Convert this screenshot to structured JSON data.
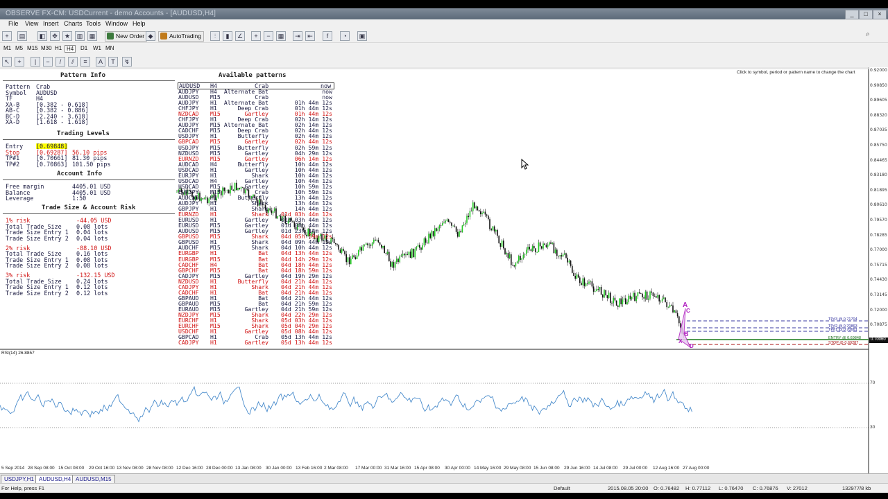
{
  "window": {
    "title": "OBSERVE FX-CM: USDCurrent - demo Accounts - [AUDUSD,H4]"
  },
  "menu": [
    "File",
    "View",
    "Insert",
    "Charts",
    "Tools",
    "Window",
    "Help"
  ],
  "toolbar": {
    "new_order": "New Order",
    "autotrading": "AutoTrading"
  },
  "timeframes": [
    "M1",
    "M5",
    "M15",
    "M30",
    "H1",
    "H4",
    "D1",
    "W1",
    "MN"
  ],
  "active_timeframe": "H4",
  "hint_text": "Click to symbol, period or pattern name to change the chart",
  "pattern_info": {
    "header": "Pattern Info",
    "rows": [
      {
        "k": "Pattern",
        "v": "Crab"
      },
      {
        "k": "Symbol",
        "v": "AUDUSD"
      },
      {
        "k": "TF",
        "v": "H4"
      },
      {
        "k": "XA-B",
        "v": "[0.382 - 0.618]"
      },
      {
        "k": "AB-C",
        "v": "[0.382 - 0.886]"
      },
      {
        "k": "BC-D",
        "v": "[2.240 - 3.618]"
      },
      {
        "k": "XA-D",
        "v": "[1.618 - 1.618]"
      }
    ]
  },
  "trading_levels": {
    "header": "Trading Levels",
    "rows": [
      {
        "k": "Entry",
        "v": "[0.69848]",
        "pips": "",
        "color": "dark"
      },
      {
        "k": "Stop",
        "v": "[0.69287]",
        "pips": "56.10 pips",
        "color": "red"
      },
      {
        "k": "TP#1",
        "v": "[0.70661]",
        "pips": "81.30 pips",
        "color": "dark"
      },
      {
        "k": "TP#2",
        "v": "[0.70863]",
        "pips": "101.50 pips",
        "color": "dark"
      }
    ]
  },
  "account_info": {
    "header": "Account Info",
    "rows": [
      {
        "k": "Free margin",
        "v": "4405.01 USD"
      },
      {
        "k": "Balance",
        "v": "4405.01 USD"
      },
      {
        "k": "Leverage",
        "v": "1:50"
      }
    ]
  },
  "trade_size": {
    "header": "Trade Size & Account Risk",
    "groups": [
      {
        "risk": "1% risk",
        "amount": "-44.05 USD",
        "total": "0.08 lots",
        "e1": "0.04 lots",
        "e2": "0.04 lots"
      },
      {
        "risk": "2% risk",
        "amount": "-88.10 USD",
        "total": "0.16 lots",
        "e1": "0.08 lots",
        "e2": "0.08 lots"
      },
      {
        "risk": "3% risk",
        "amount": "-132.15 USD",
        "total": "0.24 lots",
        "e1": "0.12 lots",
        "e2": "0.12 lots"
      }
    ],
    "labels": {
      "total": "Total Trade Size",
      "e1": "Trade Size Entry 1",
      "e2": "Trade Size Entry 2"
    }
  },
  "available_patterns": {
    "header": "Available patterns",
    "columns": [
      "AUDUSD",
      "H4",
      "Crab",
      "now"
    ],
    "rows": [
      [
        "AUDJPY",
        "H4",
        "Alternate Bat",
        "now",
        "d"
      ],
      [
        "AUDUSD",
        "M15",
        "Crab",
        "now",
        "d"
      ],
      [
        "AUDJPY",
        "H1",
        "Alternate Bat",
        "01h 44m 12s",
        "d"
      ],
      [
        "CHFJPY",
        "H1",
        "Deep Crab",
        "01h 44m 12s",
        "d"
      ],
      [
        "NZDCAD",
        "M15",
        "Gartley",
        "01h 44m 12s",
        "r"
      ],
      [
        "CHFJPY",
        "H1",
        "Deep Crab",
        "02h 14m 12s",
        "d"
      ],
      [
        "AUDJPY",
        "M15",
        "Alternate Bat",
        "02h 14m 12s",
        "d"
      ],
      [
        "CADCHF",
        "M15",
        "Deep Crab",
        "02h 44m 12s",
        "d"
      ],
      [
        "USDJPY",
        "H1",
        "Butterfly",
        "02h 44m 12s",
        "d"
      ],
      [
        "GBPCAD",
        "M15",
        "Gartley",
        "02h 44m 12s",
        "r"
      ],
      [
        "USDJPY",
        "M15",
        "Butterfly",
        "02h 59m 12s",
        "d"
      ],
      [
        "NZDUSD",
        "M15",
        "Gartley",
        "04h 29m 12s",
        "d"
      ],
      [
        "EURNZD",
        "M15",
        "Gartley",
        "06h 14m 12s",
        "r"
      ],
      [
        "AUDCAD",
        "H4",
        "Butterfly",
        "10h 44m 12s",
        "d"
      ],
      [
        "USDCAD",
        "H1",
        "Gartley",
        "10h 44m 12s",
        "d"
      ],
      [
        "EURJPY",
        "H1",
        "Shark",
        "10h 44m 12s",
        "d"
      ],
      [
        "USDCAD",
        "H4",
        "Gartley",
        "10h 44m 12s",
        "d"
      ],
      [
        "USDCAD",
        "M15",
        "Gartley",
        "10h 59m 12s",
        "d"
      ],
      [
        "EURJPY",
        "M15",
        "Crab",
        "10h 59m 12s",
        "d"
      ],
      [
        "AUDCAD",
        "H1",
        "Butterfly",
        "13h 44m 12s",
        "d"
      ],
      [
        "AUDJPY",
        "H1",
        "Shark",
        "13h 44m 12s",
        "d"
      ],
      [
        "GBPJPY",
        "H1",
        "Shark",
        "14h 44m 12s",
        "d"
      ],
      [
        "EURNZD",
        "H1",
        "Shark",
        "01d 03h 44m 12s",
        "r"
      ],
      [
        "EURUSD",
        "H1",
        "Gartley",
        "01d 03h 44m 12s",
        "d"
      ],
      [
        "EURUSD",
        "M15",
        "Gartley",
        "01d 08h 44m 12s",
        "d"
      ],
      [
        "AUDUSD",
        "M15",
        "Gartley",
        "01d 23h 14m 12s",
        "d"
      ],
      [
        "GBPUSD",
        "M15",
        "Shark",
        "04d 05h 59m 12s",
        "r"
      ],
      [
        "GBPUSD",
        "H1",
        "Shark",
        "04d 09h 44m 12s",
        "d"
      ],
      [
        "AUDCHF",
        "M15",
        "Shark",
        "04d 10h 44m 12s",
        "d"
      ],
      [
        "EURGBP",
        "H1",
        "Bat",
        "04d 13h 44m 12s",
        "r"
      ],
      [
        "EURGBP",
        "M15",
        "Bat",
        "04d 14h 29m 12s",
        "r"
      ],
      [
        "CADCHF",
        "H4",
        "Bat",
        "04d 18h 44m 12s",
        "r"
      ],
      [
        "GBPCHF",
        "M15",
        "Bat",
        "04d 18h 59m 12s",
        "r"
      ],
      [
        "CADJPY",
        "M15",
        "Gartley",
        "04d 19h 29m 12s",
        "d"
      ],
      [
        "NZDUSD",
        "H1",
        "Butterfly",
        "04d 21h 44m 12s",
        "r"
      ],
      [
        "CADJPY",
        "H1",
        "Shark",
        "04d 21h 44m 12s",
        "r"
      ],
      [
        "CADCHF",
        "H1",
        "Bat",
        "04d 21h 44m 12s",
        "r"
      ],
      [
        "GBPAUD",
        "H1",
        "Bat",
        "04d 21h 44m 12s",
        "d"
      ],
      [
        "GBPAUD",
        "M15",
        "Bat",
        "04d 21h 59m 12s",
        "d"
      ],
      [
        "EURAUD",
        "M15",
        "Gartley",
        "04d 21h 59m 12s",
        "d"
      ],
      [
        "NZDJPY",
        "M15",
        "Shark",
        "04d 22h 29m 12s",
        "r"
      ],
      [
        "EURCHF",
        "H1",
        "Shark",
        "05d 03h 44m 12s",
        "r"
      ],
      [
        "EURCHF",
        "M15",
        "Shark",
        "05d 04h 29m 12s",
        "r"
      ],
      [
        "USDCHF",
        "H1",
        "Gartley",
        "05d 08h 44m 12s",
        "r"
      ],
      [
        "GBPCAD",
        "H1",
        "Crab",
        "05d 13h 44m 12s",
        "d"
      ],
      [
        "CADJPY",
        "H1",
        "Gartley",
        "05d 13h 44m 12s",
        "r"
      ]
    ]
  },
  "price_axis": [
    "0.92000",
    "0.90850",
    "0.89605",
    "0.88320",
    "0.87035",
    "0.85750",
    "0.84465",
    "0.83180",
    "0.81895",
    "0.80610",
    "0.79570",
    "0.78285",
    "0.77000",
    "0.75715",
    "0.74430",
    "0.73145",
    "0.72000",
    "0.70875"
  ],
  "level_labels": [
    {
      "text": "TP#3 @ 0.71704",
      "color": "#2a2a9a"
    },
    {
      "text": "TP#2 @ 0.70863",
      "color": "#2a2a9a"
    },
    {
      "text": "TP#1 @ 0.70661",
      "color": "#2a2a9a"
    },
    {
      "text": "ENTRY @ 0.69848",
      "color": "#1a6a1a"
    },
    {
      "text": "STOP @ 0.69287",
      "color": "#aa1010"
    }
  ],
  "current_price": "0.70060",
  "pattern_points": [
    "A",
    "C",
    "B",
    "X",
    "D"
  ],
  "rsi": {
    "label": "RSI(14) 26.8857",
    "levels": [
      "70",
      "30"
    ]
  },
  "time_axis": [
    "5 Sep 2014",
    "28 Sep 08:00",
    "15 Oct 08:00",
    "29 Oct 16:00",
    "13 Nov 08:00",
    "28 Nov 08:00",
    "12 Dec 16:00",
    "28 Dec 00:00",
    "13 Jan 08:00",
    "30 Jan 00:00",
    "13 Feb 16:00",
    "2 Mar 08:00",
    "17 Mar 00:00",
    "31 Mar 16:00",
    "15 Apr 08:00",
    "30 Apr 00:00",
    "14 May 16:00",
    "29 May 08:00",
    "15 Jun 08:00",
    "29 Jun 16:00",
    "14 Jul 08:00",
    "29 Jul 00:00",
    "12 Aug 16:00",
    "27 Aug 00:00"
  ],
  "tabs": [
    "USDJPY,H1",
    "AUDUSD,H4",
    "AUDUSD,M15"
  ],
  "active_tab": "AUDUSD,H4",
  "status": {
    "help": "For Help, press F1",
    "profile": "Default",
    "datetime": "2015.08.05 20:00",
    "open": "O: 0.76482",
    "high": "H: 0.77112",
    "low": "L: 0.76470",
    "close": "C: 0.76876",
    "volume": "V: 27012",
    "traffic": "132977/8 kb"
  }
}
